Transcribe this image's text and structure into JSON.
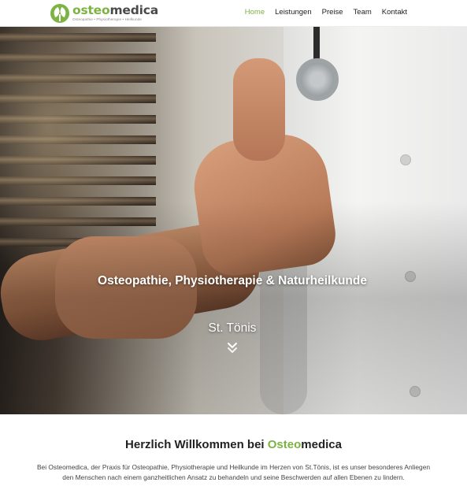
{
  "header": {
    "logo": {
      "name_green": "osteo",
      "name_dark": "medica",
      "tagline": "Osteopathie • Physiotherapie • Heilkunde"
    },
    "nav": [
      {
        "label": "Home",
        "active": true
      },
      {
        "label": "Leistungen",
        "active": false
      },
      {
        "label": "Preise",
        "active": false
      },
      {
        "label": "Team",
        "active": false
      },
      {
        "label": "Kontakt",
        "active": false
      }
    ]
  },
  "hero": {
    "title": "Osteopathie, Physiotherapie & Naturheilkunde",
    "subtitle": "St. Tönis",
    "scroll_icon": "double-chevron-down-icon"
  },
  "welcome": {
    "title_prefix": "Herzlich Willkommen bei ",
    "title_green": "Osteo",
    "title_dark": "medica",
    "text": "Bei Osteomedica, der Praxis für Osteopathie, Physiotherapie und Heilkunde im Herzen von St.Tönis, ist es unser besonderes Anliegen den Menschen nach einem ganzheitlichen Ansatz zu behandeln und seine Beschwerden auf allen Ebenen zu lindern."
  },
  "colors": {
    "brand_green": "#7cb342",
    "text_dark": "#222222"
  }
}
